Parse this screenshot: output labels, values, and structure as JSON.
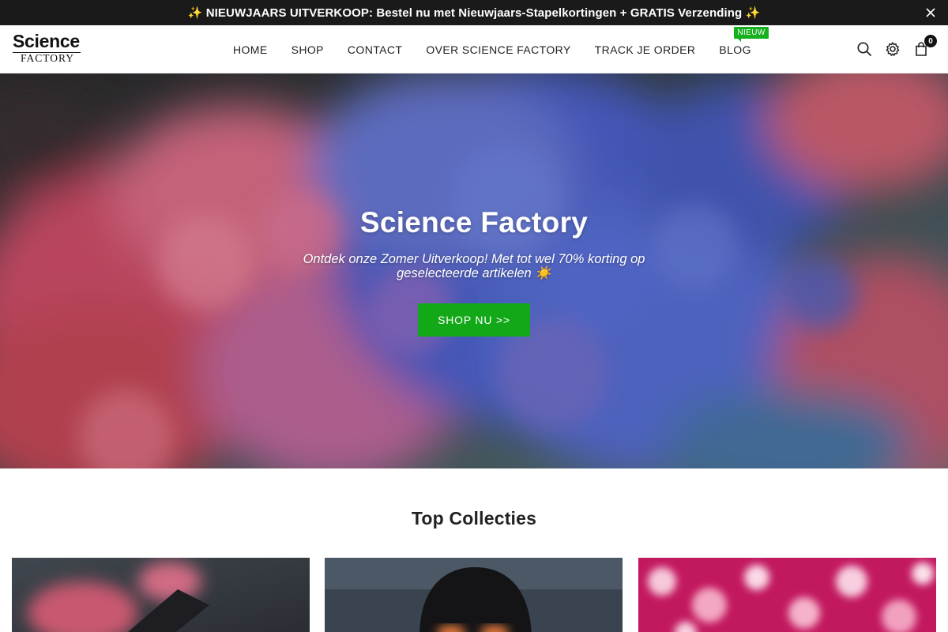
{
  "announcement": {
    "text": "✨ NIEUWJAARS UITVERKOOP: Bestel nu met Nieuwjaars-Stapelkortingen + GRATIS Verzending ✨"
  },
  "logo": {
    "line1": "Science",
    "line2": "FACTORY"
  },
  "nav": {
    "items": [
      {
        "label": "HOME"
      },
      {
        "label": "SHOP"
      },
      {
        "label": "CONTACT"
      },
      {
        "label": "OVER SCIENCE FACTORY"
      },
      {
        "label": "TRACK JE ORDER"
      },
      {
        "label": "BLOG",
        "badge": "NIEUW"
      }
    ]
  },
  "header_icons": {
    "search": "search-icon",
    "settings": "gear-icon",
    "cart": "bag-icon",
    "cart_count": "0"
  },
  "hero": {
    "title": "Science Factory",
    "subtitle": "Ontdek onze Zomer Uitverkoop! Met tot wel 70% korting op geselecteerde artikelen ☀️",
    "button_label": "SHOP NU >>"
  },
  "collections": {
    "title": "Top Collecties"
  },
  "colors": {
    "announcement_bg": "#1a1a1a",
    "accent_green": "#12a818",
    "badge_green": "#17b01e"
  }
}
